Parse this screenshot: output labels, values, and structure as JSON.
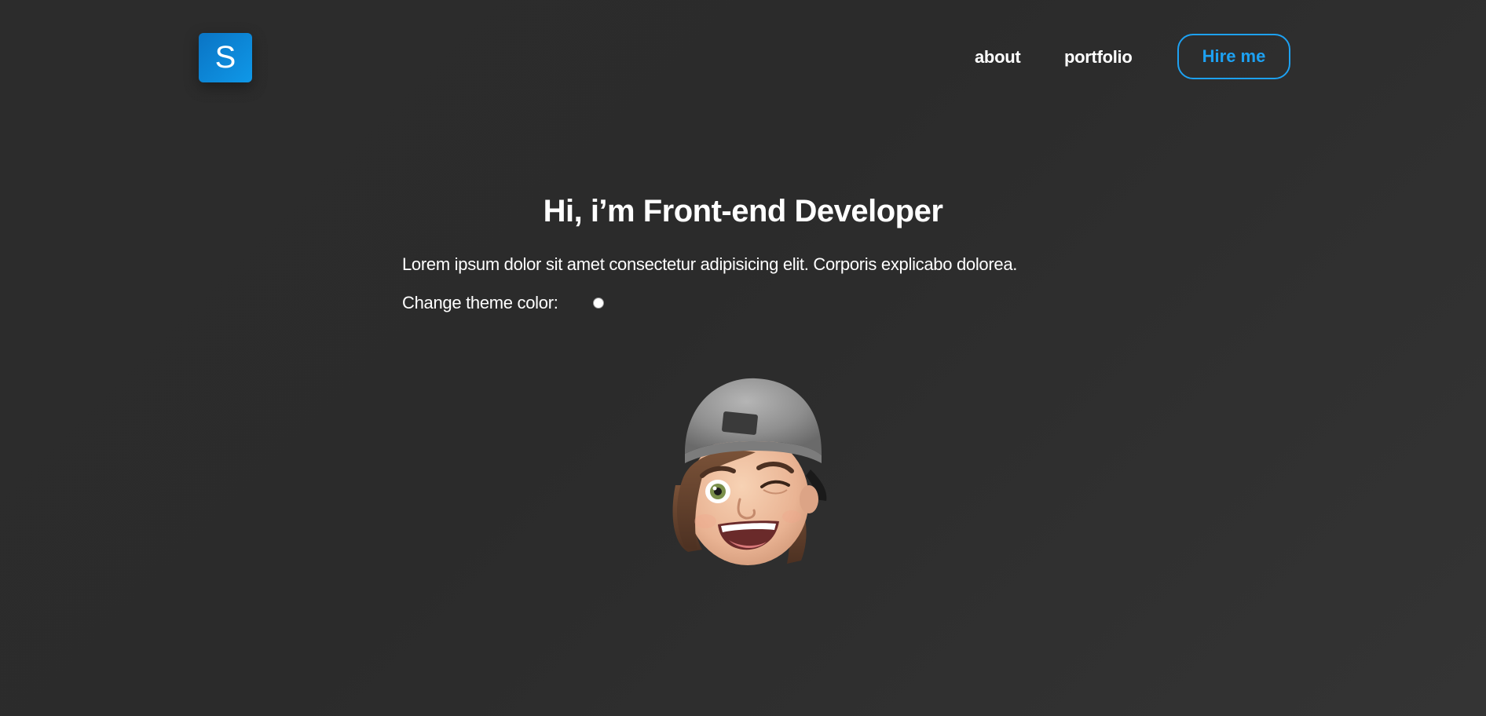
{
  "header": {
    "logo_letter": "S",
    "nav": [
      {
        "label": "about"
      },
      {
        "label": "portfolio"
      }
    ],
    "cta_label": "Hire me"
  },
  "hero": {
    "title": "Hi, i’m Front-end Developer",
    "description": "Lorem ipsum dolor sit amet consectetur adipisicing elit. Corporis explicabo dolorea.",
    "theme_label": "Change theme color:",
    "theme_toggle_on": false
  },
  "colors": {
    "background": "#2d2d2d",
    "accent": "#1da1f2",
    "logo_gradient_start": "#0a74c4",
    "logo_gradient_end": "#0f98e8",
    "text": "#ffffff"
  },
  "icons": {
    "avatar": "memoji-avatar-icon"
  }
}
